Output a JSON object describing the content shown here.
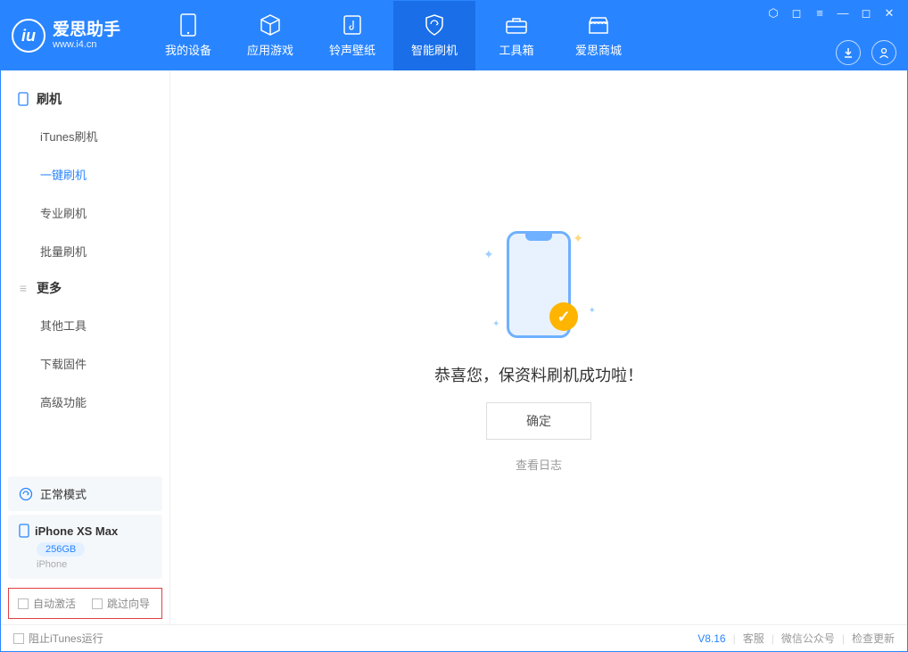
{
  "app": {
    "title": "爱思助手",
    "subtitle": "www.i4.cn"
  },
  "tabs": [
    {
      "label": "我的设备"
    },
    {
      "label": "应用游戏"
    },
    {
      "label": "铃声壁纸"
    },
    {
      "label": "智能刷机"
    },
    {
      "label": "工具箱"
    },
    {
      "label": "爱思商城"
    }
  ],
  "sidebar": {
    "group1": {
      "title": "刷机",
      "items": [
        "iTunes刷机",
        "一键刷机",
        "专业刷机",
        "批量刷机"
      ]
    },
    "group2": {
      "title": "更多",
      "items": [
        "其他工具",
        "下载固件",
        "高级功能"
      ]
    }
  },
  "status": {
    "mode": "正常模式"
  },
  "device": {
    "name": "iPhone XS Max",
    "capacity": "256GB",
    "type": "iPhone"
  },
  "options": {
    "autoActivate": "自动激活",
    "skipGuide": "跳过向导"
  },
  "main": {
    "success": "恭喜您，保资料刷机成功啦！",
    "ok": "确定",
    "viewLog": "查看日志"
  },
  "footer": {
    "blockItunes": "阻止iTunes运行",
    "version": "V8.16",
    "support": "客服",
    "wechat": "微信公众号",
    "checkUpdate": "检查更新"
  }
}
